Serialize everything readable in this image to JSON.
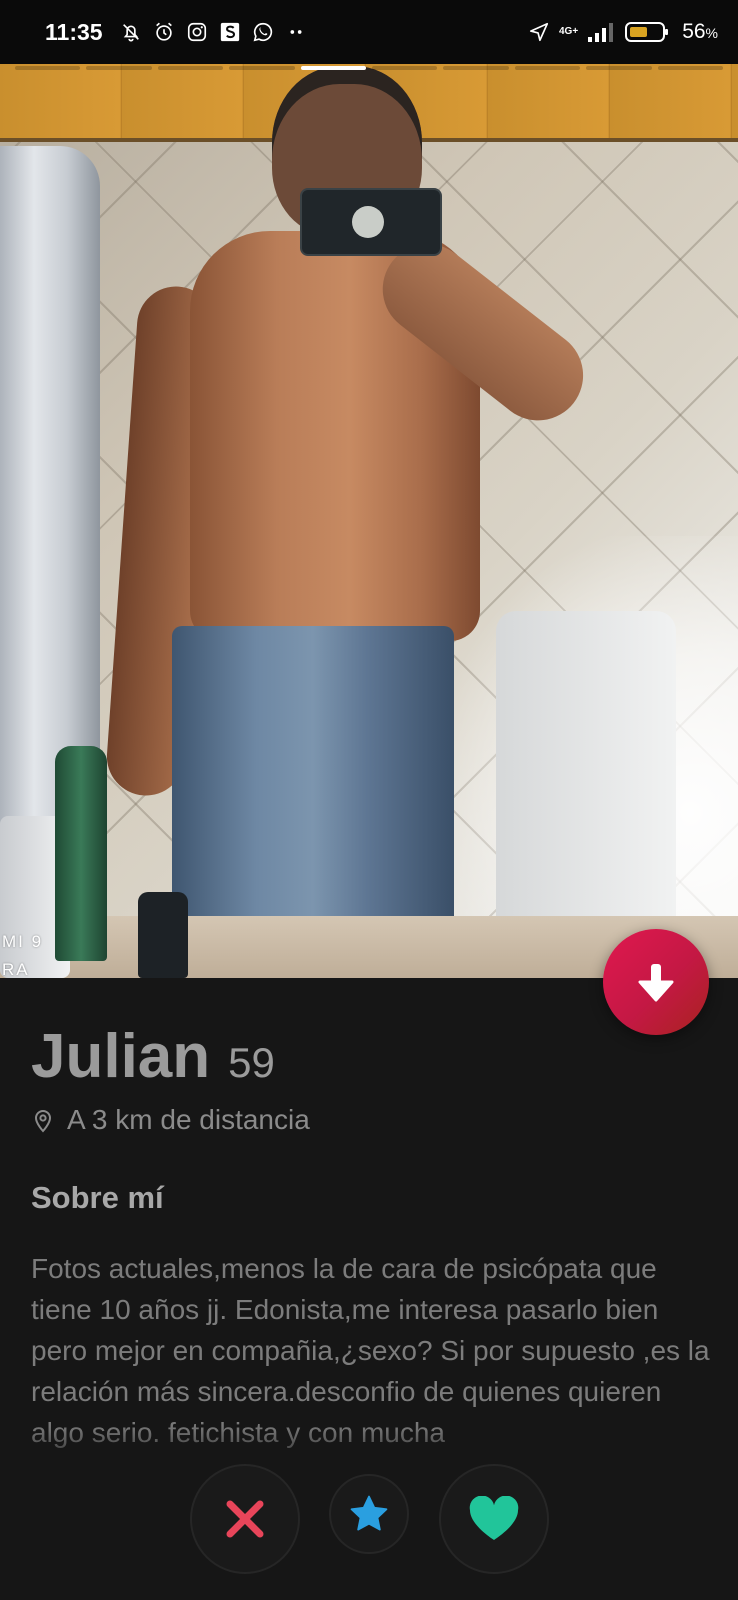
{
  "status_bar": {
    "time": "11:35",
    "network": "4G+",
    "battery": "56",
    "battery_unit": "%",
    "left_icons": [
      "bell-off-icon",
      "alarm-icon",
      "instagram-icon",
      "s-app-icon",
      "whatsapp-icon",
      "more-dots-icon"
    ],
    "right_icons": [
      "location-arrow-icon",
      "signal-icon",
      "battery-icon"
    ]
  },
  "photo": {
    "segments_total": 10,
    "active_segment": 5,
    "overlay_text": "MI 9\nRA"
  },
  "profile": {
    "name": "Julian",
    "age": "59",
    "distance": "A 3 km de distancia",
    "about_heading": "Sobre mí",
    "bio": "Fotos actuales,menos la de cara de psicópata que tiene 10 años jj. Edonista,me interesa pasarlo bien pero mejor en compañia,¿sexo? Si por supuesto ,es la relación más sincera.desconfio de quienes quieren algo serio. fetichista y con mucha"
  },
  "colors": {
    "accent": "#e0184f",
    "nope": "#e8455a",
    "super_like": "#2a9fe0",
    "like": "#21c59a",
    "background": "#161616"
  },
  "actions": [
    "nope-button",
    "super-like-button",
    "like-button"
  ]
}
